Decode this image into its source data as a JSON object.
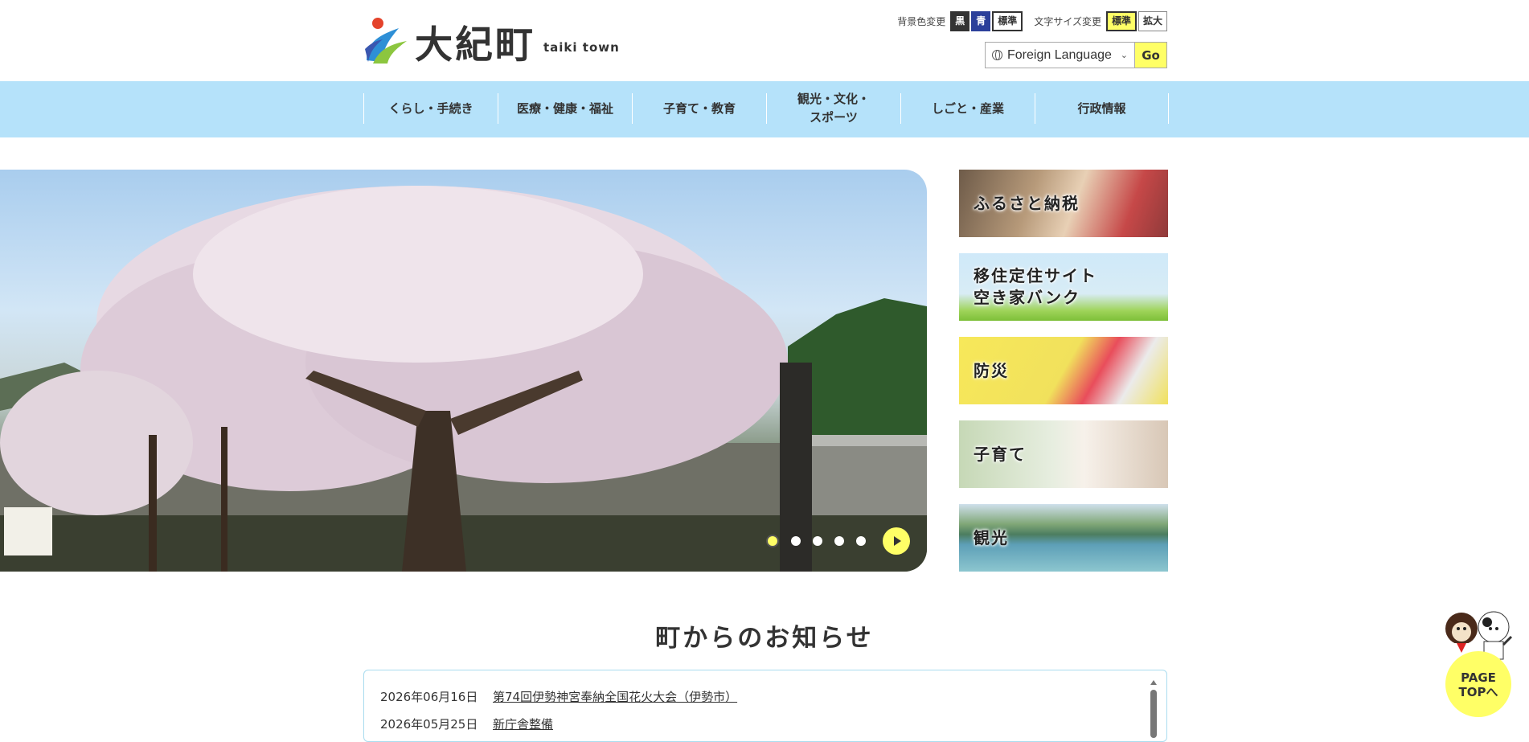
{
  "header": {
    "logo_jp": "大紀町",
    "logo_en": "taiki town",
    "bg_color_label": "背景色変更",
    "bg_black": "黒",
    "bg_blue": "青",
    "bg_standard": "標準",
    "font_size_label": "文字サイズ変更",
    "font_standard": "標準",
    "font_large": "拡大",
    "language_select": "Foreign Language",
    "language_go": "Go"
  },
  "nav": {
    "items": [
      {
        "label": "くらし・手続き"
      },
      {
        "label": "医療・健康・福祉"
      },
      {
        "label": "子育て・教育"
      },
      {
        "label": "観光・文化・\nスポーツ"
      },
      {
        "label": "しごと・産業"
      },
      {
        "label": "行政情報"
      }
    ]
  },
  "banners": [
    {
      "label": "ふるさと納税"
    },
    {
      "label": "移住定住サイト\n空き家バンク"
    },
    {
      "label": "防災"
    },
    {
      "label": "子育て"
    },
    {
      "label": "観光"
    }
  ],
  "news": {
    "title": "町からのお知らせ",
    "items": [
      {
        "date": "2026年06月16日",
        "title": "第74回伊勢神宮奉納全国花火大会（伊勢市）"
      },
      {
        "date": "2026年05月25日",
        "title": "新庁舎整備"
      }
    ]
  },
  "pagetop": {
    "line1": "PAGE",
    "line2": "TOPへ"
  },
  "colors": {
    "nav_bg": "#b5e2fa",
    "accent_yellow": "#ffff66",
    "blue_btn": "#2b3f9a"
  }
}
